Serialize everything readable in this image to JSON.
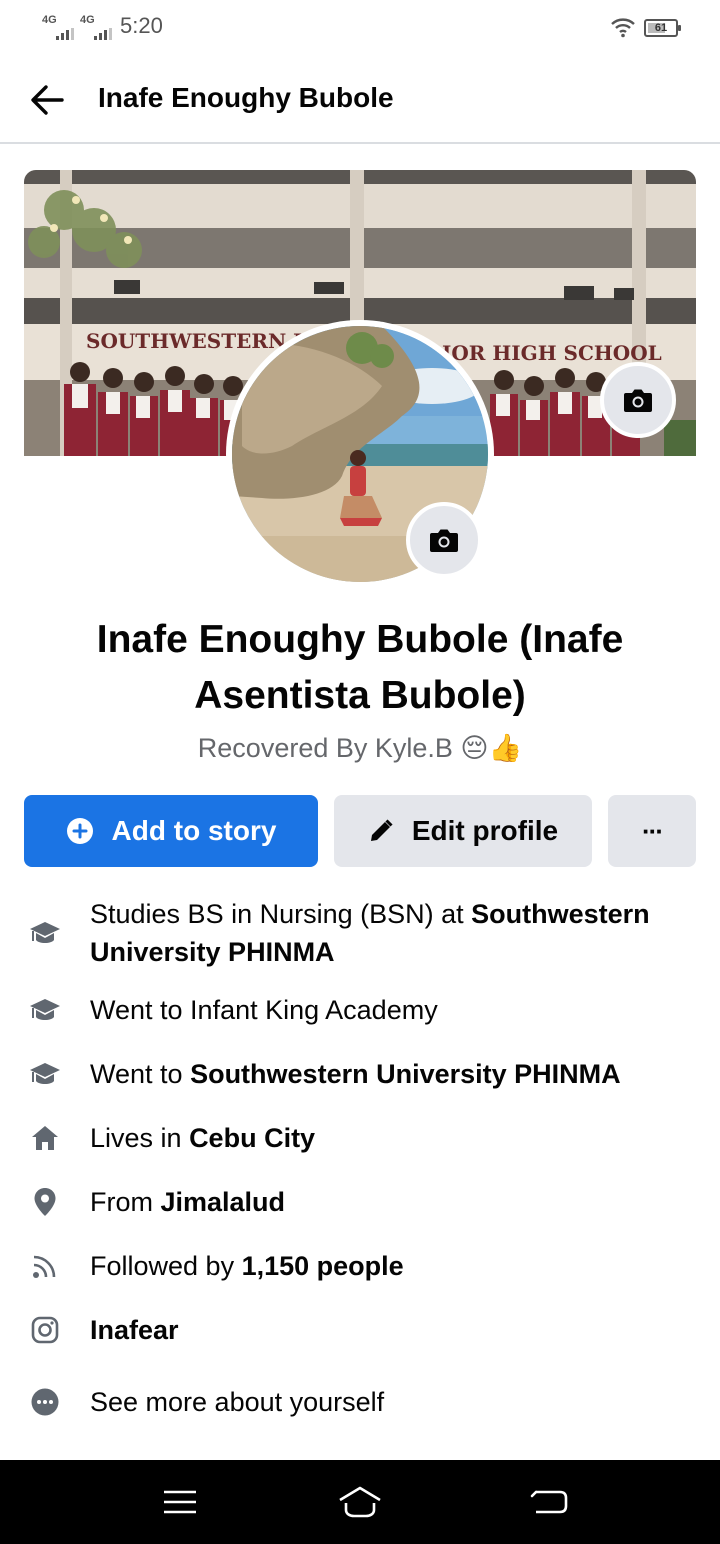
{
  "status_bar": {
    "network1": "4G",
    "network2": "4G",
    "time": "5:20",
    "battery": "61"
  },
  "header": {
    "title": "Inafe Enoughy Bubole"
  },
  "profile": {
    "name": "Inafe Enoughy Bubole (Inafe Asentista Bubole)",
    "bio": "Recovered By Kyle.B 😔👍"
  },
  "actions": {
    "add_story": "Add to story",
    "edit_profile": "Edit profile",
    "more": "···"
  },
  "details": [
    {
      "icon": "graduation-cap-icon",
      "prefix": "Studies BS in Nursing (BSN) at ",
      "bold": "Southwestern University PHINMA"
    },
    {
      "icon": "graduation-cap-icon",
      "prefix": "Went to Infant King Academy",
      "bold": ""
    },
    {
      "icon": "graduation-cap-icon",
      "prefix": "Went to ",
      "bold": "Southwestern University PHINMA"
    },
    {
      "icon": "home-icon",
      "prefix": "Lives in ",
      "bold": "Cebu City"
    },
    {
      "icon": "location-pin-icon",
      "prefix": "From ",
      "bold": "Jimalalud"
    },
    {
      "icon": "rss-feed-icon",
      "prefix": "Followed by ",
      "bold": "1,150 people"
    },
    {
      "icon": "instagram-icon",
      "prefix": "",
      "bold": "Inafear"
    },
    {
      "icon": "more-dots-icon",
      "prefix": "See more about yourself",
      "bold": ""
    }
  ],
  "cover_text": {
    "left": "SOUTHWESTERN UNIVE",
    "right": "IOR HIGH SCHOOL"
  },
  "colors": {
    "primary": "#1b74e4",
    "secondary_button": "#e4e6eb",
    "muted_text": "#65676b",
    "icon": "#606770"
  }
}
